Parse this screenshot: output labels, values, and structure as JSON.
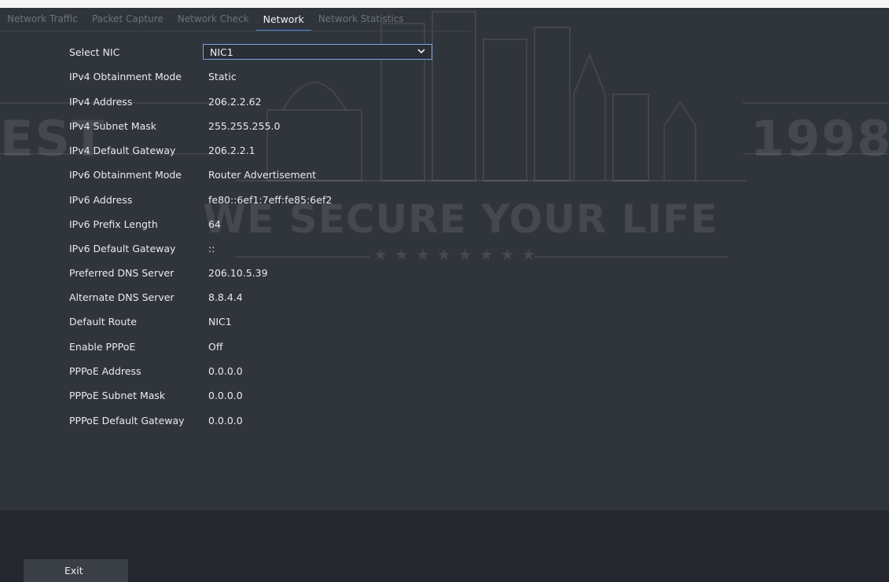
{
  "tabs": [
    {
      "label": "Network Traffic",
      "active": false
    },
    {
      "label": "Packet Capture",
      "active": false
    },
    {
      "label": "Network Check",
      "active": false
    },
    {
      "label": "Network",
      "active": true
    },
    {
      "label": "Network Statistics",
      "active": false
    }
  ],
  "form": {
    "select_nic": {
      "label": "Select NIC",
      "value": "NIC1"
    },
    "rows": [
      {
        "label": "IPv4 Obtainment Mode",
        "value": "Static"
      },
      {
        "label": "IPv4 Address",
        "value": "206.2.2.62"
      },
      {
        "label": "IPv4 Subnet Mask",
        "value": "255.255.255.0"
      },
      {
        "label": "IPv4 Default Gateway",
        "value": "206.2.2.1"
      },
      {
        "label": "IPv6 Obtainment Mode",
        "value": "Router Advertisement"
      },
      {
        "label": "IPv6 Address",
        "value": "fe80::6ef1:7eff:fe85:6ef2"
      },
      {
        "label": "IPv6 Prefix Length",
        "value": "64"
      },
      {
        "label": "IPv6 Default Gateway",
        "value": "::"
      },
      {
        "label": "Preferred DNS Server",
        "value": "206.10.5.39"
      },
      {
        "label": "Alternate DNS Server",
        "value": "8.8.4.4"
      },
      {
        "label": "Default Route",
        "value": "NIC1"
      },
      {
        "label": "Enable PPPoE",
        "value": "Off"
      },
      {
        "label": "PPPoE Address",
        "value": "0.0.0.0"
      },
      {
        "label": "PPPoE Subnet Mask",
        "value": "0.0.0.0"
      },
      {
        "label": "PPPoE Default Gateway",
        "value": "0.0.0.0"
      }
    ]
  },
  "footer": {
    "exit_label": "Exit"
  },
  "watermark": {
    "left": "EST",
    "right": "1998",
    "tagline": "WE SECURE YOUR LIFE",
    "stars": "★★★★★★★★"
  },
  "colors": {
    "accent": "#4e8de0",
    "panel_bg": "#30343b",
    "footer_bg": "#24272d"
  }
}
